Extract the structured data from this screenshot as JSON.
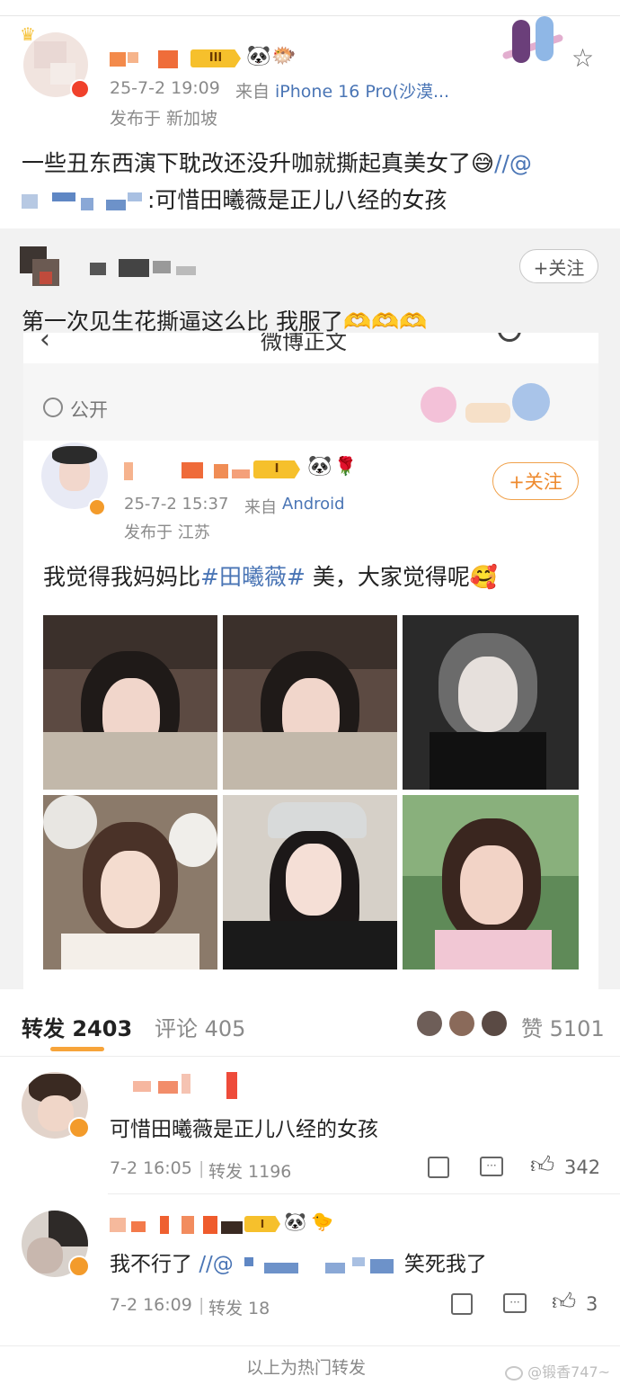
{
  "post": {
    "time": "25-7-2 19:09",
    "source_prefix": "来自",
    "source": "iPhone 16 Pro(沙漠...",
    "location": "发布于 新加坡",
    "text": "一些丑东西演下耽改还没升咖就撕起真美女了",
    "emoji": "😅",
    "repost_sep": "//@",
    "quote_text": ":可惜田曦薇是正儿八经的女孩",
    "badge_level": "III"
  },
  "repost_card": {
    "follow_label": "+关注",
    "text": "第一次见生花撕逼这么比 我服了",
    "emojis": "🫶🫶🫶",
    "screenshot": {
      "top_partial_title": "微博正文",
      "visibility_label": "公开",
      "inner_post": {
        "time": "25-7-2 15:37",
        "source_prefix": "来自",
        "source": "Android",
        "location": "发布于 江苏",
        "follow_label": "+关注",
        "text_before": "我觉得我妈妈比",
        "hashtag": "#田曦薇#",
        "text_after": " 美，大家觉得呢",
        "emoji": "🥰",
        "badge_level": "I"
      }
    }
  },
  "tabs": {
    "repost_label": "转发",
    "repost_count": "2403",
    "comment_label": "评论",
    "comment_count": "405",
    "like_label": "赞",
    "like_count": "5101"
  },
  "comments": [
    {
      "text": "可惜田曦薇是正儿八经的女孩",
      "time": "7-2 16:05",
      "repost": "转发 1196",
      "likes": "342"
    },
    {
      "text_before": "我不行了",
      "mention": "//@",
      "text_after": "笑死我了",
      "time": "7-2 16:09",
      "repost": "转发 18",
      "likes": "3",
      "badge_level": "I"
    }
  ],
  "footer": {
    "text": "以上为热门转发",
    "watermark": "@锻香747~"
  },
  "colors": {
    "link": "#4a75b5",
    "accent_orange": "#f7a43a",
    "verify_orange": "#f39b2b",
    "meta_grey": "#8a8a8a"
  }
}
